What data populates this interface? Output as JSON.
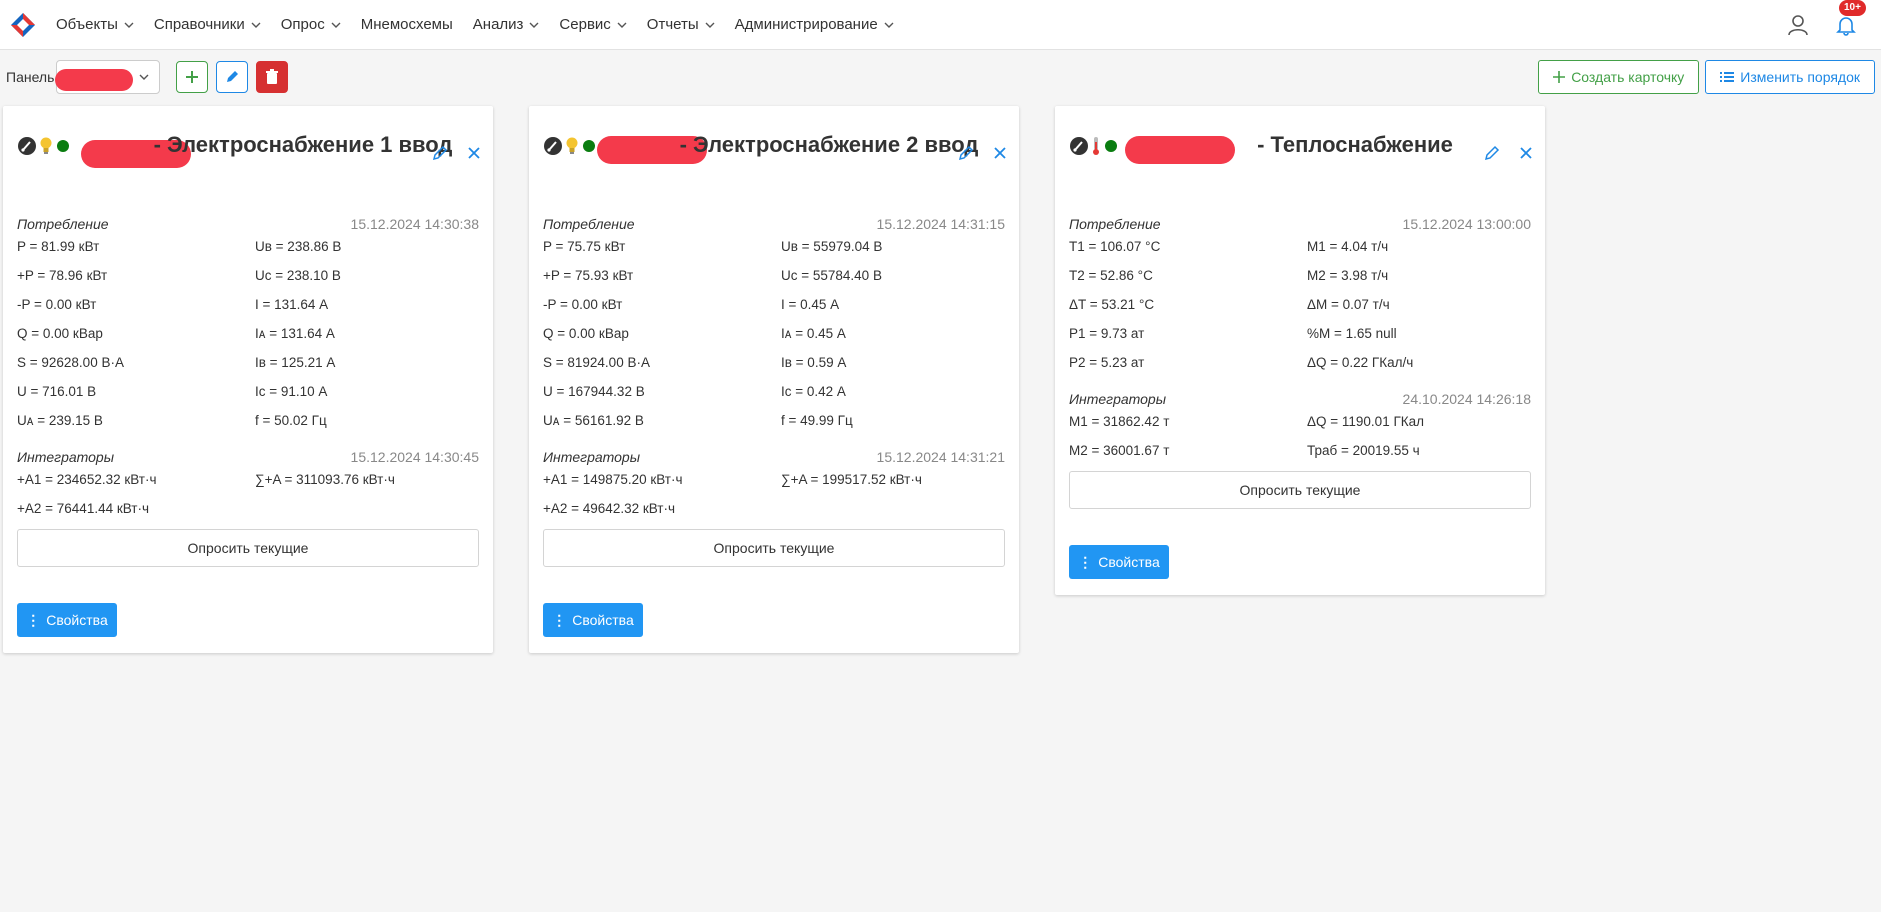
{
  "nav": {
    "menu": [
      "Объекты",
      "Справочники",
      "Опрос",
      "Мнемосхемы",
      "Анализ",
      "Сервис",
      "Отчеты",
      "Администрирование"
    ],
    "menu_has_dropdown": [
      true,
      true,
      true,
      false,
      true,
      true,
      true,
      true
    ],
    "notifications_badge": "10+"
  },
  "toolbar": {
    "panel_label": "Панель",
    "create_card_label": "Создать карточку",
    "reorder_label": "Изменить порядок"
  },
  "colors": {
    "primary": "#2196f3",
    "success": "#43a047",
    "danger": "#d63031",
    "status_ok": "#0a7d10",
    "redaction": "#f43a4b"
  },
  "cards": [
    {
      "icons": [
        "gauge-icon",
        "bulb-icon",
        "status-dot"
      ],
      "title": "- Электроснабжение 1 ввод",
      "consumption": {
        "label": "Потребление",
        "time": "15.12.2024 14:30:38",
        "left": [
          "P = 81.99 кВт",
          "+P = 78.96 кВт",
          "-P = 0.00 кВт",
          "Q = 0.00 кВар",
          "S = 92628.00 В·А",
          "U = 716.01 В",
          "Uᴀ = 239.15 В"
        ],
        "right": [
          "Uв = 238.86 В",
          "Uс = 238.10 В",
          "I = 131.64 А",
          "Iᴀ = 131.64 А",
          "Iв = 125.21 А",
          "Iс = 91.10 А",
          "f = 50.02 Гц"
        ]
      },
      "integrators": {
        "label": "Интеграторы",
        "time": "15.12.2024 14:30:45",
        "left": [
          "+A1 = 234652.32 кВт·ч",
          "+A2 = 76441.44 кВт·ч"
        ],
        "right": [
          "∑+A = 311093.76 кВт·ч",
          ""
        ]
      },
      "poll_label": "Опросить текущие",
      "props_label": "Свойства"
    },
    {
      "icons": [
        "gauge-icon",
        "bulb-icon",
        "status-dot"
      ],
      "title": "- Электроснабжение 2 ввод",
      "consumption": {
        "label": "Потребление",
        "time": "15.12.2024 14:31:15",
        "left": [
          "P = 75.75 кВт",
          "+P = 75.93 кВт",
          "-P = 0.00 кВт",
          "Q = 0.00 кВар",
          "S = 81924.00 В·А",
          "U = 167944.32 В",
          "Uᴀ = 56161.92 В"
        ],
        "right": [
          "Uв = 55979.04 В",
          "Uс = 55784.40 В",
          "I = 0.45 А",
          "Iᴀ = 0.45 А",
          "Iв = 0.59 А",
          "Iс = 0.42 А",
          "f = 49.99 Гц"
        ]
      },
      "integrators": {
        "label": "Интеграторы",
        "time": "15.12.2024 14:31:21",
        "left": [
          "+A1 = 149875.20 кВт·ч",
          "+A2 = 49642.32 кВт·ч"
        ],
        "right": [
          "∑+A = 199517.52 кВт·ч",
          ""
        ]
      },
      "poll_label": "Опросить текущие",
      "props_label": "Свойства"
    },
    {
      "icons": [
        "gauge-icon",
        "thermometer-icon",
        "status-dot"
      ],
      "title": "- Теплоснабжение",
      "consumption": {
        "label": "Потребление",
        "time": "15.12.2024 13:00:00",
        "left": [
          "T1 = 106.07 °C",
          "T2 = 52.86 °C",
          "ΔT = 53.21 °C",
          "P1 = 9.73 ат",
          "P2 = 5.23 ат"
        ],
        "right": [
          "M1 = 4.04 т/ч",
          "M2 = 3.98 т/ч",
          "ΔM = 0.07 т/ч",
          "%M = 1.65 null",
          "ΔQ = 0.22 ГКал/ч"
        ]
      },
      "integrators": {
        "label": "Интеграторы",
        "time": "24.10.2024 14:26:18",
        "left": [
          "M1 = 31862.42 т",
          "M2 = 36001.67 т"
        ],
        "right": [
          "ΔQ = 1190.01 ГКал",
          "Траб = 20019.55 ч"
        ]
      },
      "poll_label": "Опросить текущие",
      "props_label": "Свойства"
    }
  ]
}
